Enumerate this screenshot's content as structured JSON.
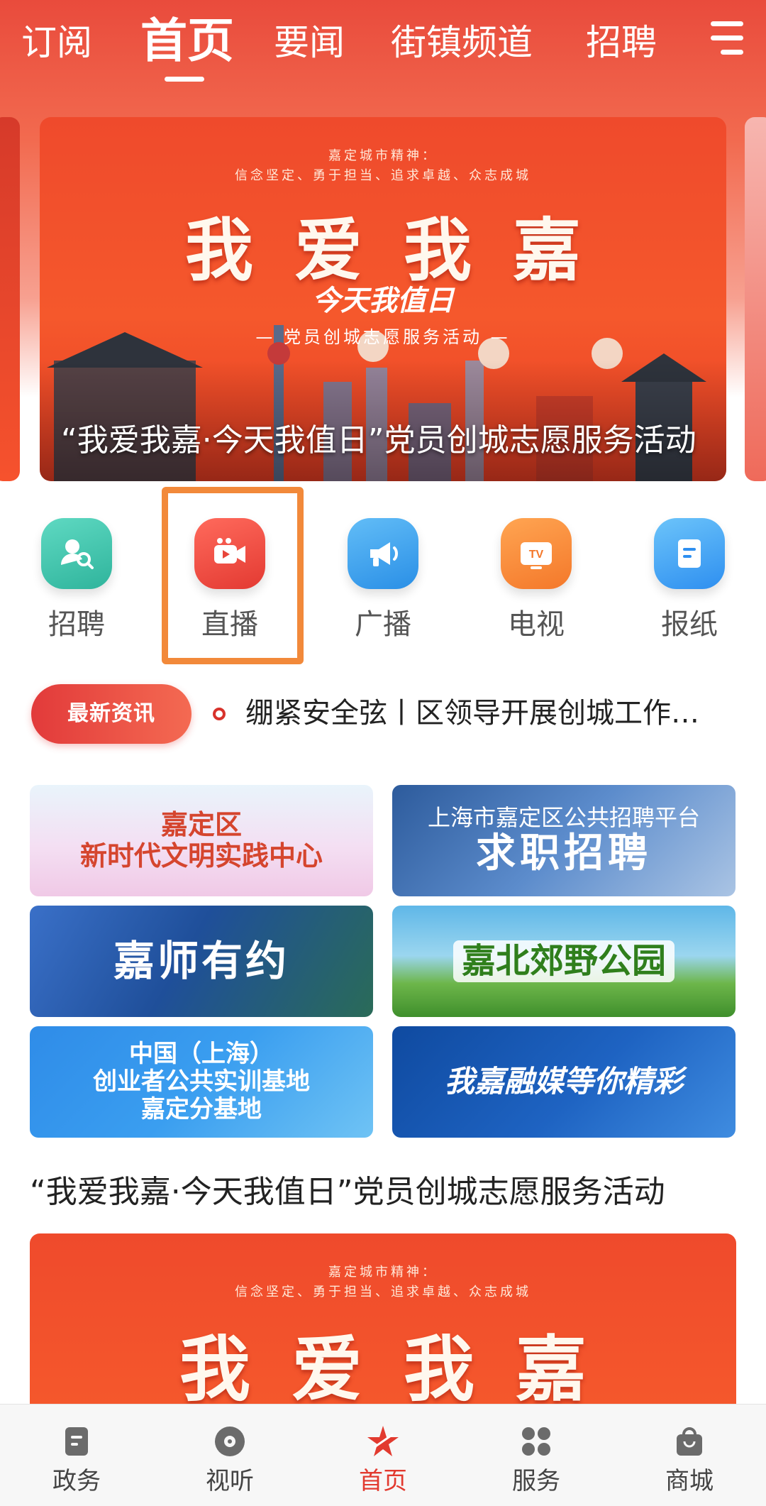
{
  "top_tabs": [
    "订阅",
    "首页",
    "要闻",
    "街镇频道",
    "招聘"
  ],
  "active_tab": "首页",
  "banner": {
    "spirit_label": "嘉定城市精神：",
    "spirit_text": "信念坚定、勇于担当、追求卓越、众志成城",
    "big_text": "我爱我嘉",
    "slogan": "今天我值日",
    "activity": "— 党员创城志愿服务活动 —",
    "caption": "“我爱我嘉·今天我值日”党员创城志愿服务活动"
  },
  "quick_entries": [
    {
      "label": "招聘",
      "icon": "recruit-icon",
      "color": "#3ec8b0"
    },
    {
      "label": "直播",
      "icon": "live-camera-icon",
      "color": "#f0443c"
    },
    {
      "label": "广播",
      "icon": "broadcast-icon",
      "color": "#3aa3f0"
    },
    {
      "label": "电视",
      "icon": "tv-icon",
      "color": "#f5862f"
    },
    {
      "label": "报纸",
      "icon": "newspaper-icon",
      "color": "#45a7f2"
    }
  ],
  "ticker": {
    "badge": "最新资讯",
    "text": "绷紧安全弦丨区领导开展创城工作检查"
  },
  "promos": {
    "p1_line1": "嘉定区",
    "p1_line2": "新时代文明实践中心",
    "p2_line1": "上海市嘉定区公共招聘平台",
    "p2_line2": "求职招聘",
    "p3": "嘉师有约",
    "p4": "嘉北郊野公园",
    "p5_line1": "中国（上海）",
    "p5_line2": "创业者公共实训基地",
    "p5_line3": "嘉定分基地",
    "p6": "我嘉融媒等你精彩"
  },
  "article": {
    "title": "“我爱我嘉·今天我值日”党员创城志愿服务活动",
    "image_spirit_label": "嘉定城市精神：",
    "image_spirit_text": "信念坚定、勇于担当、追求卓越、众志成城",
    "image_big_text": "我爱我嘉"
  },
  "bottom_nav": [
    {
      "label": "政务",
      "icon": "government-icon"
    },
    {
      "label": "视听",
      "icon": "audio-video-icon"
    },
    {
      "label": "首页",
      "icon": "home-logo-icon"
    },
    {
      "label": "服务",
      "icon": "services-grid-icon"
    },
    {
      "label": "商城",
      "icon": "shopping-bag-icon"
    }
  ],
  "colors": {
    "brand_red": "#e23a2f",
    "highlight_orange": "#f2893a"
  }
}
